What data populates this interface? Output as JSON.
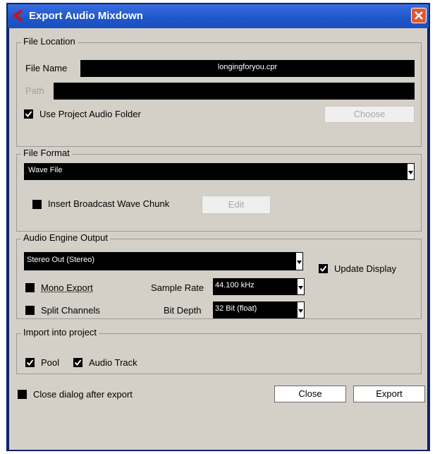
{
  "window": {
    "title": "Export Audio Mixdown"
  },
  "file_location": {
    "legend": "File Location",
    "file_name_label": "File Name",
    "file_name_value": "longingforyou.cpr",
    "path_label": "Path",
    "path_value": "",
    "use_project_folder_label": "Use Project Audio Folder",
    "use_project_folder_checked": true,
    "choose_label": "Choose"
  },
  "file_format": {
    "legend": "File Format",
    "format_value": "Wave File",
    "broadcast_label": "Insert Broadcast Wave Chunk",
    "broadcast_checked": false,
    "edit_label": "Edit"
  },
  "audio_engine": {
    "legend": "Audio Engine Output",
    "output_value": "Stereo Out (Stereo)",
    "update_display_label": "Update Display",
    "update_display_checked": true,
    "mono_export_label": "Mono Export",
    "mono_export_checked": false,
    "split_channels_label": "Split Channels",
    "split_channels_checked": false,
    "sample_rate_label": "Sample Rate",
    "sample_rate_value": "44.100 kHz",
    "bit_depth_label": "Bit Depth",
    "bit_depth_value": "32 Bit (float)"
  },
  "import": {
    "legend": "Import into project",
    "pool_label": "Pool",
    "pool_checked": true,
    "audio_track_label": "Audio Track",
    "audio_track_checked": true
  },
  "footer": {
    "close_after_label": "Close dialog after export",
    "close_after_checked": false,
    "close_button": "Close",
    "export_button": "Export"
  },
  "colors": {
    "titlebar": "#1f56c7",
    "dialog_bg": "#d4d0c8",
    "field_bg": "#000000",
    "close_x": "#e2572f",
    "logo": "#cc1111"
  },
  "icons": {
    "app_logo": "cubase-logo-icon",
    "close": "close-icon",
    "check": "check-icon",
    "dropdown": "dropdown-arrow-icon"
  }
}
